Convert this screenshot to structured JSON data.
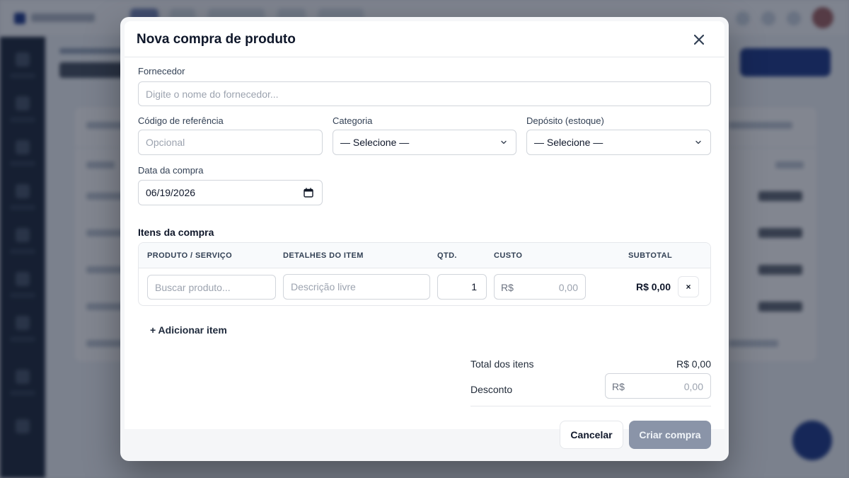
{
  "modal": {
    "title": "Nova compra de produto",
    "fields": {
      "supplier_label": "Fornecedor",
      "supplier_placeholder": "Digite o nome do fornecedor...",
      "reference_label": "Código de referência",
      "reference_placeholder": "Opcional",
      "category_label": "Categoria",
      "category_value": "— Selecione —",
      "warehouse_label": "Depósito (estoque)",
      "warehouse_value": "— Selecione —",
      "date_label": "Data da compra",
      "date_value": "06/19/2026"
    },
    "items": {
      "section_title": "Itens da compra",
      "columns": [
        "PRODUTO / SERVIÇO",
        "DETALHES DO ITEM",
        "QTD.",
        "CUSTO",
        "SUBTOTAL"
      ],
      "row": {
        "product_placeholder": "Buscar produto...",
        "details_placeholder": "Descrição livre",
        "qty": "1",
        "cost_prefix": "R$",
        "cost_value": "0,00",
        "subtotal": "R$ 0,00",
        "remove_label": "×"
      },
      "add_label": "+ Adicionar item"
    },
    "summary": {
      "total_label": "Total dos itens",
      "total_value": "R$ 0,00",
      "discount_label": "Desconto",
      "discount_prefix": "R$",
      "discount_value": "0,00"
    },
    "footer": {
      "cancel_label": "Cancelar",
      "create_label": "Criar compra"
    }
  },
  "colors": {
    "overlay": "#0f172a",
    "primary": "#1e3a8a",
    "create_disabled": "#8a94a8"
  },
  "icons": {
    "close": "close-icon",
    "select": "chevron-down-icon",
    "date": "calendar-icon"
  }
}
